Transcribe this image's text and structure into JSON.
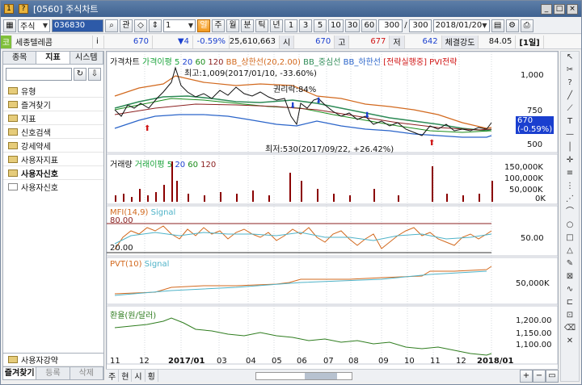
{
  "window": {
    "title": "[0560] 주식차트"
  },
  "toolbar": {
    "market_select": "주식",
    "code": "036830",
    "periods": [
      "주",
      "월",
      "분",
      "틱",
      "년"
    ],
    "minute_buttons": [
      "1",
      "3",
      "5",
      "10",
      "30",
      "60"
    ],
    "count1": "300",
    "count2": "300",
    "date": "2018/01/20"
  },
  "quote": {
    "name": "세종텔레콤",
    "price": "670",
    "change_arrow": "▼",
    "change": "4",
    "change_rate": "-0.59%",
    "volume": "25,610,663",
    "open_label": "시",
    "open": "670",
    "high_label": "고",
    "high": "677",
    "low_label": "저",
    "low": "642",
    "strength_label": "체결강도",
    "strength": "84.05",
    "period_label": "[1일]"
  },
  "left_panel": {
    "tabs": [
      "종목",
      "지표",
      "시스템"
    ],
    "folders": [
      "유형",
      "즐겨찾기",
      "지표",
      "신호검색",
      "강세약세",
      "사용자지표",
      "사용자신호"
    ],
    "sub_items": [
      "사용자신호"
    ],
    "bottom_folder": "사용자강약",
    "bottom_tabs": [
      "즐겨찾기",
      "등록",
      "삭제"
    ]
  },
  "chart": {
    "price_panel": {
      "legend": [
        "가격차트",
        "가격이평 5",
        "20",
        "60",
        "120",
        "BB_상한선(20,2.00)",
        "BB_중심선",
        "BB_하한선",
        "[전략실행중]",
        "PVI전략"
      ],
      "annotations": {
        "high": "최고:1,009(2017/01/10, -33.60%)",
        "low": "최저:530(2017/09/22, +26.42%)",
        "loss": "권리락:84%"
      },
      "y_ticks": [
        "1,000",
        "750",
        "500"
      ],
      "current_price": "670",
      "current_change": "(-0.59%)"
    },
    "volume_panel": {
      "legend": [
        "거래량",
        "거래이평 5",
        "20",
        "60",
        "120"
      ],
      "y_ticks": [
        "150,000K",
        "100,000K",
        "50,000K",
        "0K"
      ]
    },
    "mfi_panel": {
      "legend": [
        "MFI(14,9)",
        "Signal"
      ],
      "levels": [
        "80.00",
        "20.00"
      ],
      "y_ticks": [
        "50.00"
      ]
    },
    "pvt_panel": {
      "legend": [
        "PVT(10)",
        "Signal"
      ],
      "y_ticks": [
        "50,000K"
      ]
    },
    "fx_panel": {
      "legend": [
        "환율(원/달러)"
      ],
      "y_ticks": [
        "1,200.00",
        "1,150.00",
        "1,100.00"
      ]
    },
    "x_ticks": [
      "11",
      "12",
      "2017/01",
      "03",
      "04",
      "05",
      "06",
      "07",
      "08",
      "09",
      "10",
      "11",
      "12",
      "2018/01"
    ]
  },
  "bottom_bar": [
    "주",
    "현",
    "시",
    "횡"
  ],
  "colors": {
    "price": "#111111",
    "ma5": "#1aa33a",
    "ma20": "#1a3fcf",
    "ma60": "#1a8c1a",
    "ma120": "#c0392b",
    "bb_upper": "#d2691e",
    "bb_mid": "#2e8b57",
    "bb_lower": "#2a64c9",
    "volume": "#8b0000",
    "mfi": "#d2691e",
    "fx": "#2f7d1f"
  }
}
